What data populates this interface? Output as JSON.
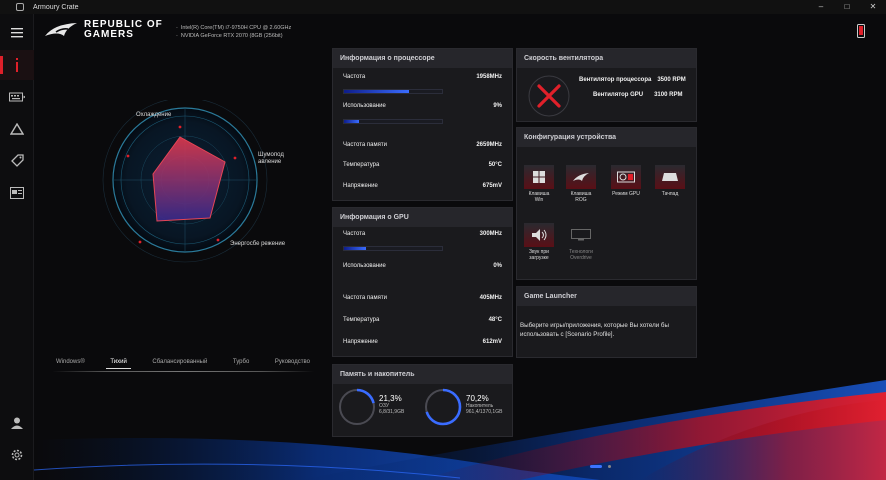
{
  "window": {
    "title": "Armoury Crate",
    "controls": [
      "–",
      "□",
      "✕"
    ]
  },
  "header": {
    "brand_line1": "REPUBLIC OF",
    "brand_line2": "GAMERS",
    "cpu": "Intel(R) Core(TM) i7-9750H CPU @ 2.60GHz",
    "gpu": "NVIDIA GeForce RTX 2070 (8GB (256bit)"
  },
  "radar": {
    "labels": {
      "cooling": "Охлаждение",
      "noise_line1": "Шумопод",
      "noise_line2": "авление",
      "energy": "Энергосбе режение"
    }
  },
  "modes": {
    "items": [
      "Windows®",
      "Тихий",
      "Сбалансированный",
      "Турбо",
      "Руководство"
    ],
    "active_index": 1
  },
  "cpu_panel": {
    "title": "Информация о процессоре",
    "freq_label": "Частота",
    "freq_value": "1958MHz",
    "freq_fraction": 0.66,
    "usage_label": "Использование",
    "usage_value": "9%",
    "usage_fraction": 0.09,
    "mem_freq_label": "Частота памяти",
    "mem_freq_value": "2659MHz",
    "temp_label": "Температура",
    "temp_value": "50°C",
    "volt_label": "Напряжение",
    "volt_value": "675mV"
  },
  "gpu_panel": {
    "title": "Информация о GPU",
    "freq_label": "Частота",
    "freq_value": "300MHz",
    "freq_fraction": 0.22,
    "usage_label": "Использование",
    "usage_value": "0%",
    "mem_freq_label": "Частота памяти",
    "mem_freq_value": "405MHz",
    "temp_label": "Температура",
    "temp_value": "48°C",
    "volt_label": "Напряжение",
    "volt_value": "612mV"
  },
  "storage_panel": {
    "title": "Память и накопитель",
    "ram_percent": "21,3%",
    "ram_label": "ОЗУ",
    "ram_detail": "6,8/31,9GB",
    "ram_fraction": 0.213,
    "disk_percent": "70,2%",
    "disk_label": "Накопитель",
    "disk_detail": "961,4/1370,1GB",
    "disk_fraction": 0.702
  },
  "fan_panel": {
    "title": "Скорость вентилятора",
    "cpu_fan_label": "Вентилятор процессора",
    "cpu_fan_value": "3500 RPM",
    "gpu_fan_label": "Вентилятор GPU",
    "gpu_fan_value": "3100 RPM"
  },
  "config_panel": {
    "title": "Конфигурация устройства",
    "items": [
      {
        "line1": "Клавиша",
        "line2": "Win",
        "icon": "windows-key-icon"
      },
      {
        "line1": "Клавиша",
        "line2": "ROG",
        "icon": "rog-key-icon"
      },
      {
        "line1": "Режим GPU",
        "line2": "",
        "icon": "gpu-mode-icon"
      },
      {
        "line1": "Тачпад",
        "line2": "",
        "icon": "touchpad-icon"
      },
      {
        "line1": "Звук при",
        "line2": "загрузке",
        "icon": "boot-sound-icon"
      },
      {
        "line1": "Технологи",
        "line2": "Overdrive",
        "icon": "overdrive-icon"
      }
    ]
  },
  "launcher_panel": {
    "title": "Game Launcher",
    "text": "Выберите игры/приложения, которые Вы хотели бы использовать с [Scenario Profile]."
  },
  "colors": {
    "accent": "#e0202a",
    "bar": "#3a6cff"
  }
}
